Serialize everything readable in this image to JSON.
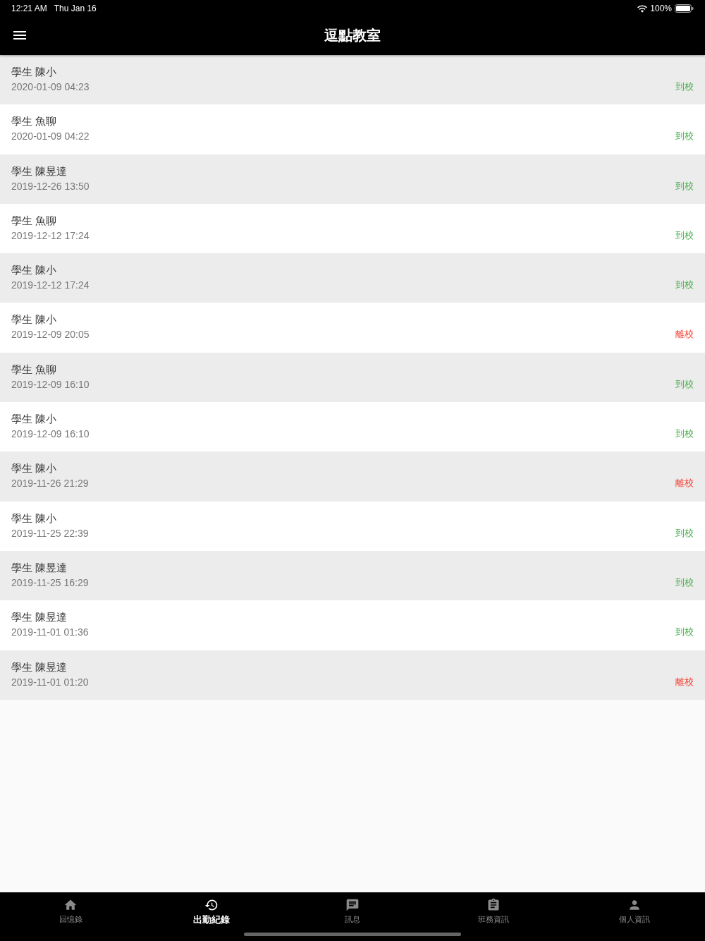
{
  "status_bar": {
    "time": "12:21 AM",
    "date": "Thu Jan 16",
    "battery": "100%"
  },
  "header": {
    "title": "逗點教室"
  },
  "records": [
    {
      "name": "學生 陳小",
      "time": "2020-01-09 04:23",
      "status": {
        "label": "到校",
        "kind": "arrive"
      }
    },
    {
      "name": "學生 魚聊",
      "time": "2020-01-09 04:22",
      "status": {
        "label": "到校",
        "kind": "arrive"
      }
    },
    {
      "name": "學生 陳昱達",
      "time": "2019-12-26 13:50",
      "status": {
        "label": "到校",
        "kind": "arrive"
      }
    },
    {
      "name": "學生 魚聊",
      "time": "2019-12-12 17:24",
      "status": {
        "label": "到校",
        "kind": "arrive"
      }
    },
    {
      "name": "學生 陳小",
      "time": "2019-12-12 17:24",
      "status": {
        "label": "到校",
        "kind": "arrive"
      }
    },
    {
      "name": "學生 陳小",
      "time": "2019-12-09 20:05",
      "status": {
        "label": "離校",
        "kind": "leave"
      }
    },
    {
      "name": "學生 魚聊",
      "time": "2019-12-09 16:10",
      "status": {
        "label": "到校",
        "kind": "arrive"
      }
    },
    {
      "name": "學生 陳小",
      "time": "2019-12-09 16:10",
      "status": {
        "label": "到校",
        "kind": "arrive"
      }
    },
    {
      "name": "學生 陳小",
      "time": "2019-11-26 21:29",
      "status": {
        "label": "離校",
        "kind": "leave"
      }
    },
    {
      "name": "學生 陳小",
      "time": "2019-11-25 22:39",
      "status": {
        "label": "到校",
        "kind": "arrive"
      }
    },
    {
      "name": "學生 陳昱達",
      "time": "2019-11-25 16:29",
      "status": {
        "label": "到校",
        "kind": "arrive"
      }
    },
    {
      "name": "學生 陳昱達",
      "time": "2019-11-01 01:36",
      "status": {
        "label": "到校",
        "kind": "arrive"
      }
    },
    {
      "name": "學生 陳昱達",
      "time": "2019-11-01 01:20",
      "status": {
        "label": "離校",
        "kind": "leave"
      }
    }
  ],
  "tab_bar": [
    {
      "label": "回憶錄",
      "selected": false
    },
    {
      "label": "出勤紀錄",
      "selected": true
    },
    {
      "label": "訊息",
      "selected": false
    },
    {
      "label": "班務資訊",
      "selected": false
    },
    {
      "label": "個人資訊",
      "selected": false
    }
  ]
}
